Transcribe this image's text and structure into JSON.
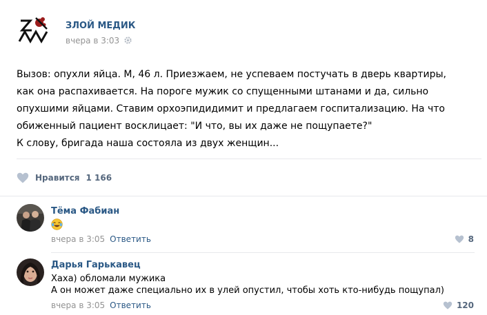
{
  "post": {
    "author": "ЗЛОЙ МЕДИК",
    "time": "вчера в 3:03",
    "logo_icon": "zm-logo-icon",
    "text_lines": [
      "Вызов: опухли яйца. М, 46 л. Приезжаем, не успеваем постучать в дверь квартиры,",
      "как она распахивается. На пороге мужик со спущенными штанами и да, сильно",
      "опухшими яйцами. Ставим орхоэпидидимит и предлагаем госпитализацию. На что",
      "обиженный пациент восклицает: \"И что, вы их даже не пощупаете?\"",
      "К слову, бригада наша состояла из двух женщин..."
    ],
    "like_label": "Нравится",
    "like_count": "1 166",
    "accent_color": "#2a5885"
  },
  "comments": [
    {
      "name": "Тёма Фабиан",
      "text": "",
      "emoji": "tears-of-joy-emoji",
      "time": "вчера в 3:05",
      "reply_label": "Ответить",
      "likes": "8"
    },
    {
      "name": "Дарья Гарькавец",
      "text_lines": [
        "Хаха) обломали мужика",
        "А он может даже специально их в улей опустил, чтобы хоть кто-нибудь пощупал)"
      ],
      "time": "вчера в 3:05",
      "reply_label": "Ответить",
      "likes": "120"
    }
  ]
}
